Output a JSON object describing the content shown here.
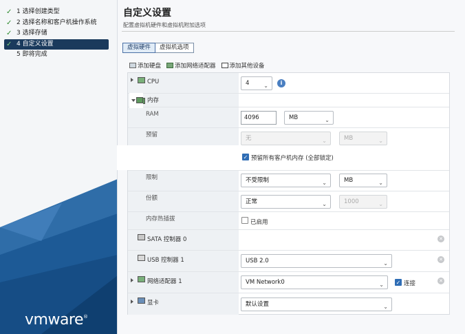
{
  "steps": [
    {
      "label": "1 选择创建类型",
      "checked": true,
      "active": false
    },
    {
      "label": "2 选择名称和客户机操作系统",
      "checked": true,
      "active": false
    },
    {
      "label": "3 选择存储",
      "checked": true,
      "active": false
    },
    {
      "label": "4 自定义设置",
      "checked": true,
      "active": true
    },
    {
      "label": "5 即将完成",
      "checked": false,
      "active": false
    }
  ],
  "brand": {
    "logo": "vmware",
    "registered": "®"
  },
  "header": {
    "title": "自定义设置",
    "subtitle": "配置虚拟机硬件和虚拟机附加选项"
  },
  "tabs": [
    {
      "label": "虚拟硬件",
      "active": true
    },
    {
      "label": "虚拟机选项",
      "active": false
    }
  ],
  "toolbar": {
    "add_disk": "添加硬盘",
    "add_nic": "添加网络适配器",
    "add_other": "添加其他设备"
  },
  "hardware": {
    "cpu": {
      "label": "CPU",
      "value": "4",
      "info": "i"
    },
    "memory": {
      "label": "内存",
      "ram_label": "RAM",
      "ram_value": "4096",
      "ram_unit": "MB",
      "reserve_label": "预留",
      "reserve_value": "无",
      "reserve_unit": "MB",
      "reserve_all_label": "预留所有客户机内存 (全部锁定)",
      "reserve_all_checked": true,
      "limit_label": "限制",
      "limit_value": "不受限制",
      "limit_unit": "MB",
      "shares_label": "份额",
      "shares_value": "正常",
      "shares_amount": "1000",
      "hotplug_label": "内存热插拔",
      "hotplug_checkbox_label": "已启用",
      "hotplug_checked": false
    },
    "sata": {
      "label": "SATA 控制器 0"
    },
    "usb": {
      "label": "USB 控制器 1",
      "value": "USB 2.0"
    },
    "nic": {
      "label": "网络适配器 1",
      "value": "VM Network0",
      "connect_label": "连接",
      "connect_checked": true
    },
    "gpu": {
      "label": "显卡",
      "value": "默认设置"
    }
  },
  "colors": {
    "accent": "#1a3a5c",
    "check": "#2e8b2e",
    "tab_active": "#e1ecf7"
  }
}
